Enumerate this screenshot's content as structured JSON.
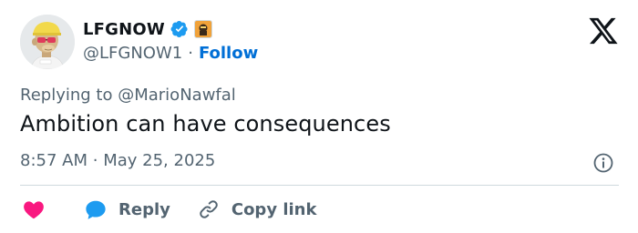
{
  "author": {
    "display_name": "LFGNOW",
    "handle": "@LFGNOW1",
    "avatar_icon": "ape-avatar-icon",
    "verified_icon": "verified-badge-icon",
    "affiliate_icon": "affiliate-badge-icon"
  },
  "header": {
    "separator": "·",
    "follow_label": "Follow",
    "platform_icon": "x-logo-icon"
  },
  "reply_context": {
    "prefix": "Replying to",
    "mention": "@MarioNawfal"
  },
  "tweet": {
    "text": "Ambition can have consequences",
    "time": "8:57 AM",
    "separator": "·",
    "date": "May 25, 2025"
  },
  "actions": {
    "like_icon": "heart-icon",
    "reply_label": "Reply",
    "reply_icon": "reply-bubble-icon",
    "copy_label": "Copy link",
    "copy_icon": "link-icon"
  },
  "colors": {
    "link_blue": "#006fd6",
    "verified_blue": "#1d9bf0",
    "heart_pink": "#f91880",
    "muted_text": "#536471",
    "primary_text": "#0f1419"
  }
}
